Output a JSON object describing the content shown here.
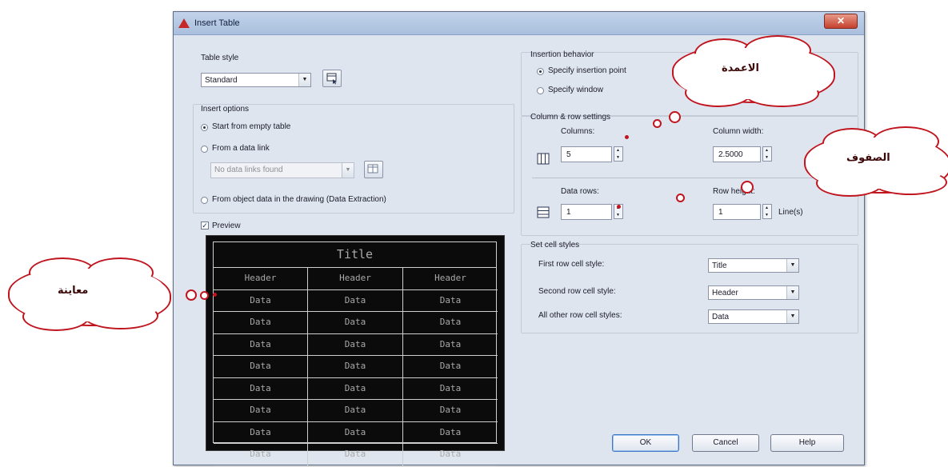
{
  "window": {
    "title": "Insert Table",
    "close_glyph": "✕"
  },
  "table_style": {
    "heading": "Table style",
    "selected": "Standard",
    "launch_icon": "table-style-dialog-icon"
  },
  "insert_options": {
    "heading": "Insert options",
    "start_empty": "Start from empty table",
    "from_data_link": "From a data link",
    "data_link_selected": "No data links found",
    "from_object_data": "From object data in the drawing (Data Extraction)",
    "selected_option": "start_empty"
  },
  "preview": {
    "checkbox_label": "Preview",
    "checked": true,
    "title": "Title",
    "headers": [
      "Header",
      "Header",
      "Header"
    ],
    "rows": [
      [
        "Data",
        "Data",
        "Data"
      ],
      [
        "Data",
        "Data",
        "Data"
      ],
      [
        "Data",
        "Data",
        "Data"
      ],
      [
        "Data",
        "Data",
        "Data"
      ],
      [
        "Data",
        "Data",
        "Data"
      ],
      [
        "Data",
        "Data",
        "Data"
      ],
      [
        "Data",
        "Data",
        "Data"
      ],
      [
        "Data",
        "Data",
        "Data"
      ]
    ]
  },
  "insertion_behavior": {
    "heading": "Insertion behavior",
    "insertion_point": "Specify insertion point",
    "window": "Specify window",
    "selected_option": "insertion_point"
  },
  "column_row": {
    "heading": "Column & row settings",
    "columns_label": "Columns:",
    "columns_value": "5",
    "column_width_label": "Column width:",
    "column_width_value": "2.5000",
    "data_rows_label": "Data rows:",
    "data_rows_value": "1",
    "row_height_label": "Row height:",
    "row_height_value": "1",
    "row_height_unit": "Line(s)"
  },
  "cell_styles": {
    "heading": "Set cell styles",
    "first_row_label": "First row cell style:",
    "first_row_value": "Title",
    "second_row_label": "Second row cell style:",
    "second_row_value": "Header",
    "other_rows_label": "All other row cell styles:",
    "other_rows_value": "Data"
  },
  "buttons": {
    "ok": "OK",
    "cancel": "Cancel",
    "help": "Help"
  },
  "callouts": {
    "columns": "الاعمدة",
    "rows": "الصفوف",
    "preview": "معاينة"
  },
  "colors": {
    "callout_outline": "#c0141e",
    "preview_bg": "#0b0b0b",
    "window_bg": "#dfe5ef"
  }
}
